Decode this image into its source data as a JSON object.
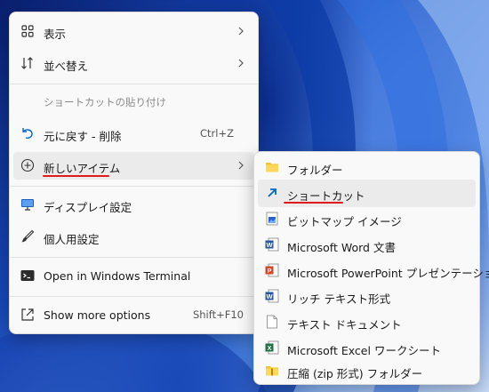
{
  "main_menu": {
    "items": [
      {
        "label": "表示",
        "icon": "grid-icon",
        "submenu": true
      },
      {
        "label": "並べ替え",
        "icon": "sort-icon",
        "submenu": true
      },
      {
        "label": "ショートカットの貼り付け",
        "disabled": true
      },
      {
        "label": "元に戻す - 削除",
        "icon": "undo-icon",
        "shortcut": "Ctrl+Z"
      },
      {
        "label": "新しいアイテム",
        "icon": "add-circle-icon",
        "submenu": true,
        "highlighted": true
      },
      {
        "label": "ディスプレイ設定",
        "icon": "display-icon"
      },
      {
        "label": "個人用設定",
        "icon": "brush-icon"
      },
      {
        "label": "Open in Windows Terminal",
        "icon": "terminal-icon"
      },
      {
        "label": "Show more options",
        "icon": "share-icon",
        "shortcut": "Shift+F10"
      }
    ]
  },
  "submenu": {
    "items": [
      {
        "label": "フォルダー",
        "icon": "folder-icon"
      },
      {
        "label": "ショートカット",
        "icon": "shortcut-arrow-icon",
        "highlighted": true
      },
      {
        "label": "ビットマップ イメージ",
        "icon": "bitmap-icon"
      },
      {
        "label": "Microsoft Word 文書",
        "icon": "word-icon"
      },
      {
        "label": "Microsoft PowerPoint プレゼンテーション",
        "icon": "powerpoint-icon"
      },
      {
        "label": "リッチ テキスト形式",
        "icon": "rtf-icon"
      },
      {
        "label": "テキスト ドキュメント",
        "icon": "text-document-icon"
      },
      {
        "label": "Microsoft Excel ワークシート",
        "icon": "excel-icon"
      },
      {
        "label": "圧縮 (zip 形式) フォルダー",
        "icon": "zip-folder-icon"
      }
    ]
  },
  "colors": {
    "highlight_underline": "#e01b1b",
    "menu_bg": "#f9f9f9",
    "hover_bg": "#ebebeb",
    "accent_blue": "#0067c0"
  }
}
